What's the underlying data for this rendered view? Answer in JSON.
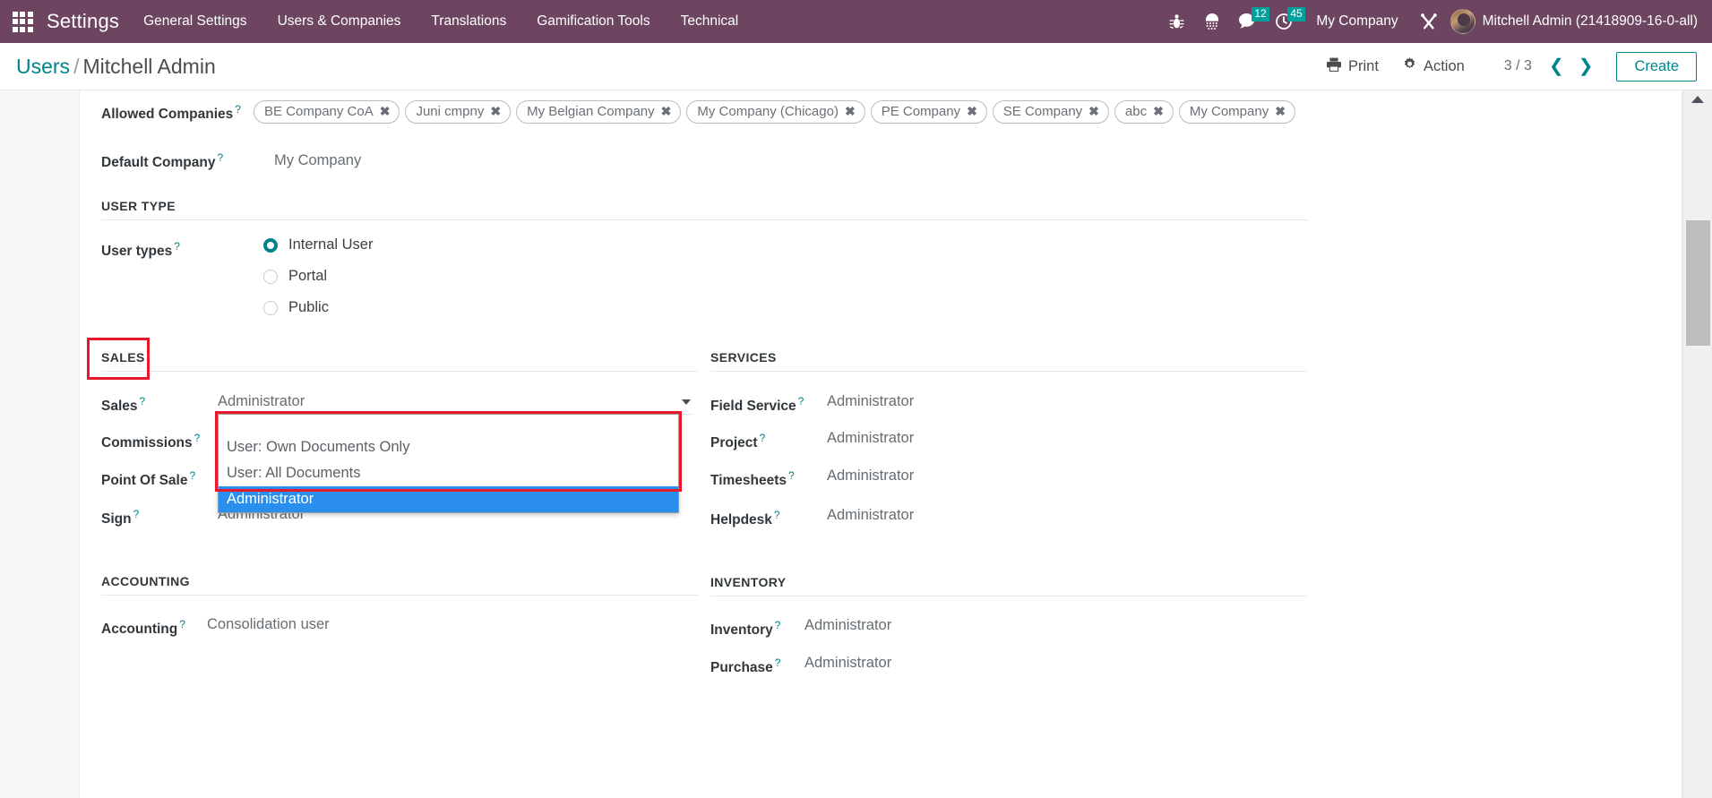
{
  "navbar": {
    "brand": "Settings",
    "apps_icon": "apps-grid-icon",
    "menu": [
      {
        "label": "General Settings"
      },
      {
        "label": "Users & Companies"
      },
      {
        "label": "Translations"
      },
      {
        "label": "Gamification Tools"
      },
      {
        "label": "Technical"
      }
    ],
    "icons": [
      {
        "name": "bug-icon"
      },
      {
        "name": "debug-assets-icon"
      }
    ],
    "messages_badge": "12",
    "activities_badge": "45",
    "company": "My Company",
    "tools_icon": "wrench-screwdriver-icon",
    "user": "Mitchell Admin (21418909-16-0-all)",
    "accent": "#6d4560"
  },
  "control_panel": {
    "breadcrumb_root": "Users",
    "breadcrumb_sep": "/",
    "breadcrumb_current": "Mitchell Admin",
    "print_label": "Print",
    "action_label": "Action",
    "pager": "3 / 3",
    "prev_icon": "chevron-left-icon",
    "next_icon": "chevron-right-icon",
    "create_label": "Create"
  },
  "form": {
    "allowed_companies": {
      "label": "Allowed Companies",
      "tags": [
        "BE Company CoA",
        "Juni cmpny",
        "My Belgian Company",
        "My Company (Chicago)",
        "PE Company",
        "SE Company",
        "abc",
        "My Company"
      ]
    },
    "default_company": {
      "label": "Default Company",
      "value": "My Company"
    },
    "user_type": {
      "section": "USER TYPE",
      "label": "User types",
      "options": [
        {
          "label": "Internal User",
          "checked": true
        },
        {
          "label": "Portal",
          "checked": false
        },
        {
          "label": "Public",
          "checked": false
        }
      ]
    },
    "sales": {
      "section": "SALES",
      "rows": [
        {
          "label": "Sales",
          "value": "Administrator"
        },
        {
          "label": "Commissions",
          "value": ""
        },
        {
          "label": "Point Of Sale",
          "value": ""
        },
        {
          "label": "Sign",
          "value": "Administrator"
        }
      ],
      "dropdown": {
        "selected": "Administrator",
        "options": [
          {
            "label": "User: Own Documents Only",
            "selected": false
          },
          {
            "label": "User: All Documents",
            "selected": false
          },
          {
            "label": "Administrator",
            "selected": true
          }
        ]
      }
    },
    "services": {
      "section": "SERVICES",
      "rows": [
        {
          "label": "Field Service",
          "value": "Administrator"
        },
        {
          "label": "Project",
          "value": "Administrator"
        },
        {
          "label": "Timesheets",
          "value": "Administrator"
        },
        {
          "label": "Helpdesk",
          "value": "Administrator"
        }
      ]
    },
    "accounting": {
      "section": "ACCOUNTING",
      "rows": [
        {
          "label": "Accounting",
          "value": "Consolidation user"
        }
      ]
    },
    "inventory": {
      "section": "INVENTORY",
      "rows": [
        {
          "label": "Inventory",
          "value": "Administrator"
        },
        {
          "label": "Purchase",
          "value": "Administrator"
        }
      ]
    }
  },
  "highlight_color": "#e8192c"
}
